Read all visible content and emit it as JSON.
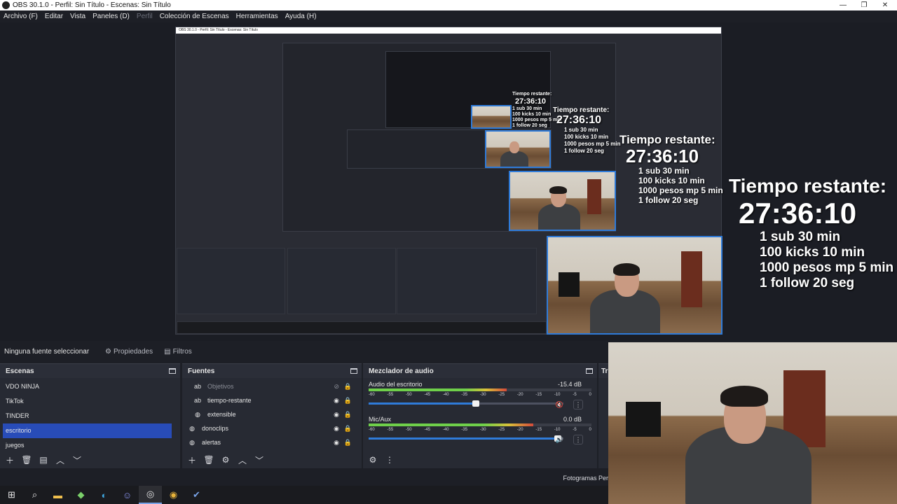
{
  "window": {
    "title": "OBS 30.1.0 - Perfil: Sin Título - Escenas: Sin Título",
    "minimize": "—",
    "maximize": "❐",
    "close": "✕"
  },
  "menu": {
    "archivo": "Archivo (F)",
    "editar": "Editar",
    "vista": "Vista",
    "paneles": "Paneles (D)",
    "perfil": "Perfil",
    "coleccion": "Colección de Escenas",
    "herramientas": "Herramientas",
    "ayuda": "Ayuda (H)"
  },
  "overlay": {
    "label": "Tiempo restante:",
    "time": "27:36:10",
    "lines": [
      "1 sub 30 min",
      "100 kicks 10 min",
      "1000 pesos mp 5 min",
      "1 follow 20 seg"
    ]
  },
  "source_bar": {
    "no_source": "Ninguna fuente seleccionar",
    "properties": "Propiedades",
    "filters": "Filtros"
  },
  "scenes": {
    "title": "Escenas",
    "items": [
      "VDO NINJA",
      "TikTok",
      "TINDER",
      "escritorio",
      "juegos"
    ],
    "active": "escritorio"
  },
  "sources": {
    "title": "Fuentes",
    "items": [
      {
        "name": "Objetivos",
        "icon": "text-icon",
        "glyph": "ab",
        "hidden": true
      },
      {
        "name": "tiempo-restante",
        "icon": "text-icon",
        "glyph": "ab",
        "hidden": false
      },
      {
        "name": "extensible",
        "icon": "browser-icon",
        "glyph": "◍",
        "hidden": false
      },
      {
        "name": "donoclips",
        "icon": "browser-icon",
        "glyph": "◍",
        "hidden": false
      },
      {
        "name": "alertas",
        "icon": "browser-icon",
        "glyph": "◍",
        "hidden": false
      }
    ]
  },
  "mixer": {
    "title": "Mezclador de audio",
    "ticks": [
      "-60",
      "-55",
      "-50",
      "-45",
      "-40",
      "-35",
      "-30",
      "-25",
      "-20",
      "-15",
      "-10",
      "-5",
      "0"
    ],
    "channels": [
      {
        "name": "Audio del escritorio",
        "db": "-15.4 dB",
        "level": 0.62,
        "volume": 0.55,
        "muted": true
      },
      {
        "name": "Mic/Aux",
        "db": "0.0 dB",
        "level": 0.74,
        "volume": 0.97,
        "muted": false
      }
    ]
  },
  "transitions": {
    "title": "Tr"
  },
  "status": {
    "fps": "Fotogramas Per"
  },
  "colors": {
    "accent": "#284cb8",
    "highlight": "#2f7bd9",
    "panel": "#272a33",
    "background": "#1d1f26"
  }
}
